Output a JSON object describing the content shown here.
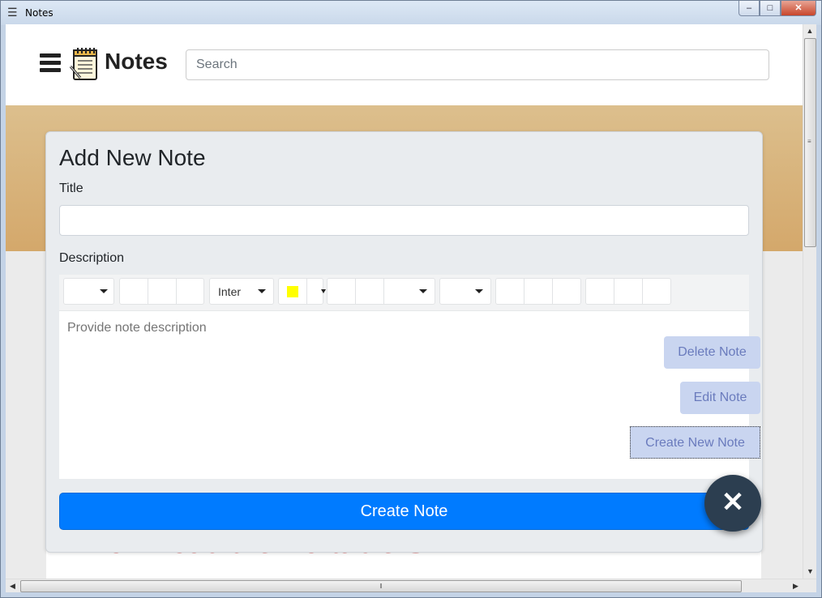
{
  "window": {
    "title": "Notes",
    "app_icon": "notepad-icon",
    "controls": {
      "minimize": "–",
      "maximize": "□",
      "close": "✕"
    }
  },
  "header": {
    "menu_icon": "hamburger-menu-icon",
    "logo_icon": "notepad-icon",
    "brand": "Notes",
    "search_placeholder": "Search",
    "search_value": ""
  },
  "modal": {
    "heading": "Add New Note",
    "title_label": "Title",
    "title_value": "",
    "description_label": "Description",
    "description_placeholder": "Provide note description",
    "toolbar": {
      "font_family": "Inter",
      "highlight_color": "#ffff00"
    },
    "submit_label": "Create Note"
  },
  "floating_actions": {
    "delete_label": "Delete Note",
    "edit_label": "Edit Note",
    "create_label": "Create New Note",
    "close_icon": "close-x-icon",
    "close_glyph": "✕"
  },
  "background": {
    "heading": "Download the Portable SDK"
  },
  "colors": {
    "primary": "#007bff",
    "fab_dark": "#2c3e50",
    "action_bg": "#c9d5f0",
    "action_text": "#6a7bbd",
    "accent_red": "#e05a5a"
  }
}
